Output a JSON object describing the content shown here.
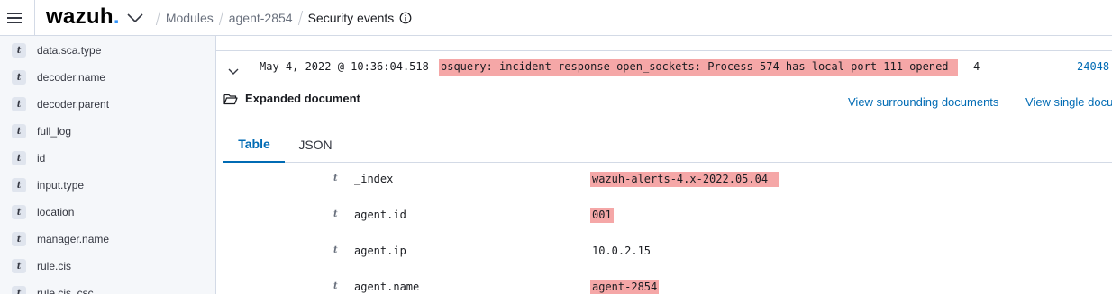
{
  "header": {
    "logo_text": "wazuh",
    "logo_dot": ".",
    "breadcrumbs": [
      "Modules",
      "agent-2854"
    ],
    "current": "Security events"
  },
  "sidebar": {
    "fields": [
      {
        "type": "t",
        "name": "data.sca.type"
      },
      {
        "type": "t",
        "name": "decoder.name"
      },
      {
        "type": "t",
        "name": "decoder.parent"
      },
      {
        "type": "t",
        "name": "full_log"
      },
      {
        "type": "t",
        "name": "id"
      },
      {
        "type": "t",
        "name": "input.type"
      },
      {
        "type": "t",
        "name": "location"
      },
      {
        "type": "t",
        "name": "manager.name"
      },
      {
        "type": "t",
        "name": "rule.cis"
      },
      {
        "type": "t",
        "name": "rule.cis_csc"
      }
    ]
  },
  "document": {
    "time": "May 4, 2022 @ 10:36:04.518",
    "description": "osquery: incident-response open_sockets: Process 574 has local port 111 opened",
    "level": "4",
    "rule_id": "24048"
  },
  "expanded": {
    "title": "Expanded document",
    "view_surrounding": "View surrounding documents",
    "view_single": "View single document",
    "tabs": [
      "Table",
      "JSON"
    ],
    "active_tab": "Table"
  },
  "fields_table": [
    {
      "type": "t",
      "key": "_index",
      "value": "wazuh-alerts-4.x-2022.05.04"
    },
    {
      "type": "t",
      "key": "agent.id",
      "value": "001"
    },
    {
      "type": "t",
      "key": "agent.ip",
      "value": "10.0.2.15"
    },
    {
      "type": "t",
      "key": "agent.name",
      "value": "agent-2854"
    }
  ],
  "colors": {
    "link": "#006bb4",
    "highlight": "#f5a7a7",
    "logo_dot": "#3595f9",
    "sidebar_bg": "#f5f7fa"
  }
}
